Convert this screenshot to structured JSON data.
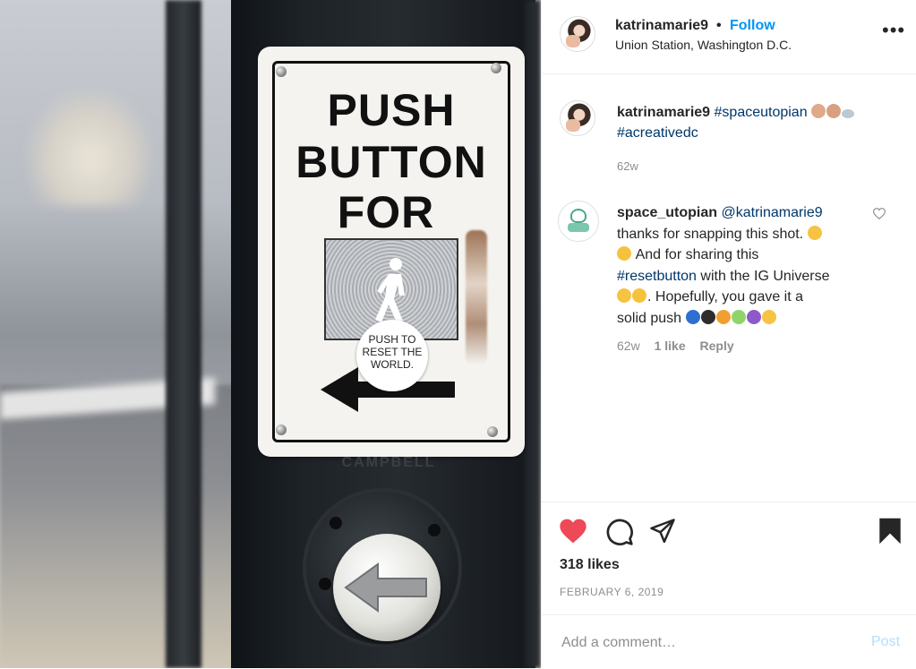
{
  "post": {
    "username": "katrinamarie9",
    "follow_label": "Follow",
    "dot": "•",
    "location": "Union Station, Washington D.C.",
    "more_label": "•••"
  },
  "photo": {
    "sign_lines": [
      "PUSH",
      "BUTTON",
      "FOR"
    ],
    "sticker_lines": [
      "PUSH TO",
      "RESET THE",
      "WORLD."
    ],
    "brand": "CAMPBELL"
  },
  "caption": {
    "username": "katrinamarie9",
    "hashtags": [
      "#spaceutopian",
      "#acreativedc"
    ],
    "time": "62w"
  },
  "comment": {
    "username": "space_utopian",
    "mention": "@katrinamarie9",
    "text_1": "thanks for snapping this shot.",
    "text_2": "And for sharing this",
    "hashtag": "#resetbutton",
    "text_3": "with the IG Universe",
    "text_4": ". Hopefully, you gave it a",
    "text_5": "solid push",
    "time": "62w",
    "likes": "1 like",
    "reply": "Reply"
  },
  "stats": {
    "likes": "318 likes",
    "date": "FEBRUARY 6, 2019"
  },
  "add_comment": {
    "placeholder": "Add a comment…",
    "post_label": "Post"
  },
  "colors": {
    "link": "#00376b",
    "follow": "#0095f6",
    "like_red": "#ed4956",
    "muted": "#8e8e8e"
  }
}
